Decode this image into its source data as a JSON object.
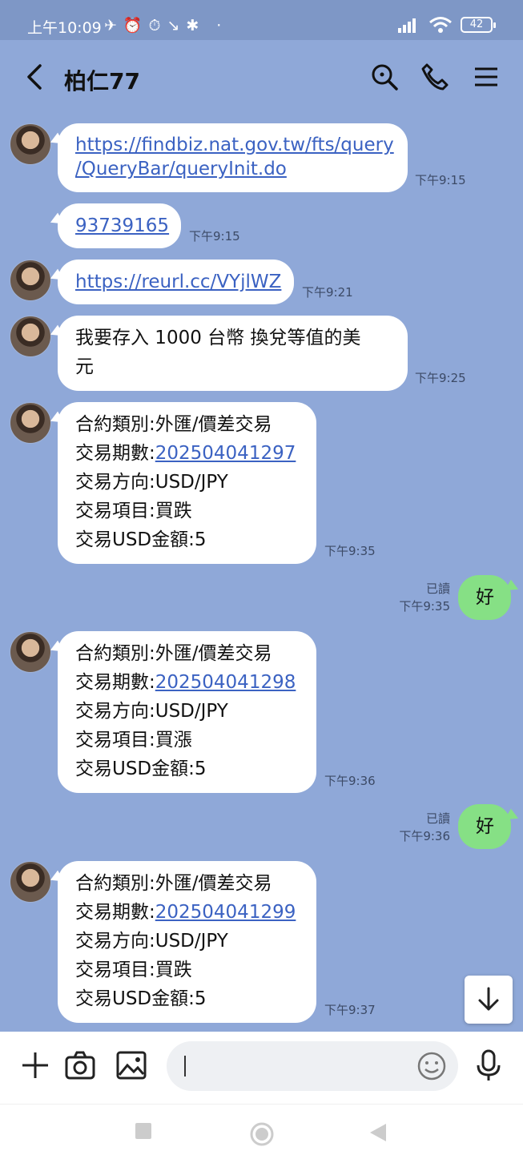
{
  "status_bar": {
    "time": "上午10:09",
    "icons": "✈⏰⏱↘✱ ·",
    "battery": "42"
  },
  "header": {
    "contact_name": "柏仁77"
  },
  "messages": {
    "m1": {
      "line1": "https://findbiz.nat.gov.tw/fts/query",
      "line2": "/QueryBar/queryInit.do",
      "time": "下午9:15"
    },
    "m2": {
      "text": "93739165",
      "time": "下午9:15"
    },
    "m3": {
      "text": "https://reurl.cc/VYjlWZ",
      "time": "下午9:21"
    },
    "m4": {
      "line1": "我要存入 1000 台幣 換兌等值的美",
      "line2": "元",
      "time": "下午9:25"
    },
    "m5": {
      "line1": "合約類別:外匯/價差交易",
      "line2_label": "交易期數:",
      "line2_link": "202504041297",
      "line3": "交易方向:USD/JPY",
      "line4": "交易項目:買跌",
      "line5": "交易USD金額:5",
      "time": "下午9:35"
    },
    "r1": {
      "text": "好",
      "read": "已讀",
      "time": "下午9:35"
    },
    "m6": {
      "line1": "合約類別:外匯/價差交易",
      "line2_label": "交易期數:",
      "line2_link": "202504041298",
      "line3": "交易方向:USD/JPY",
      "line4": "交易項目:買漲",
      "line5": "交易USD金額:5",
      "time": "下午9:36"
    },
    "r2": {
      "text": "好",
      "read": "已讀",
      "time": "下午9:36"
    },
    "m7": {
      "line1": "合約類別:外匯/價差交易",
      "line2_label": "交易期數:",
      "line2_link": "202504041299",
      "line3": "交易方向:USD/JPY",
      "line4": "交易項目:買跌",
      "line5": "交易USD金額:5",
      "time": "下午9:37"
    }
  },
  "icons": {
    "back": "back-icon",
    "search": "search-icon",
    "call": "phone-icon",
    "menu": "menu-icon",
    "add": "plus-icon",
    "camera": "camera-icon",
    "image": "image-icon",
    "emoji": "emoji-icon",
    "mic": "mic-icon",
    "scroll_down": "arrow-down-icon"
  }
}
